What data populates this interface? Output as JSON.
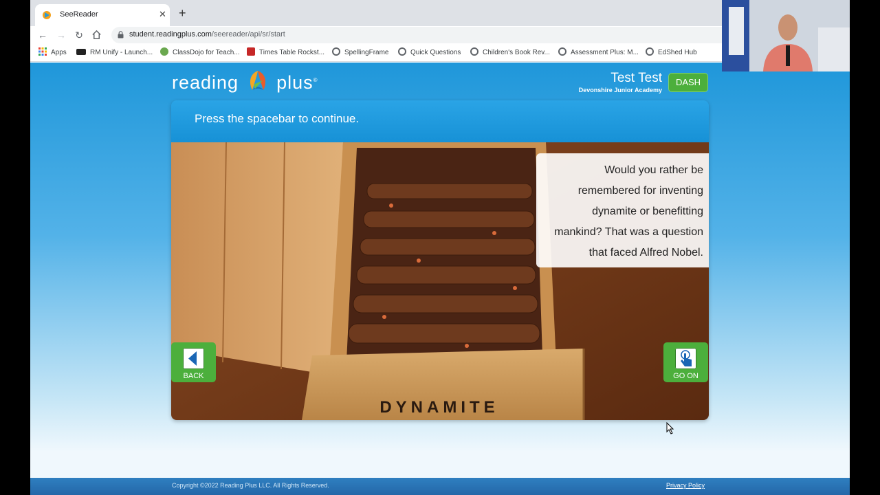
{
  "browser": {
    "tab_title": "SeeReader",
    "new_tab_icon": "+",
    "url_host": "student.readingplus.com",
    "url_path": "/seereader/api/sr/start"
  },
  "bookmarks": [
    {
      "label": "Apps",
      "icon": "apps-grid-icon",
      "color": "#e94235"
    },
    {
      "label": "RM Unify - Launch...",
      "icon": "rm-icon",
      "color": "#222222"
    },
    {
      "label": "ClassDojo for Teach...",
      "icon": "classdojo-icon",
      "color": "#6aa84f"
    },
    {
      "label": "Times Table Rockst...",
      "icon": "ttrs-icon",
      "color": "#c62828"
    },
    {
      "label": "SpellingFrame",
      "icon": "globe-icon",
      "color": "#5f6368"
    },
    {
      "label": "Quick Questions",
      "icon": "globe-icon",
      "color": "#5f6368"
    },
    {
      "label": "Children's Book Rev...",
      "icon": "globe-icon",
      "color": "#5f6368"
    },
    {
      "label": "Assessment Plus: M...",
      "icon": "globe-icon",
      "color": "#5f6368"
    },
    {
      "label": "EdShed Hub",
      "icon": "globe-icon",
      "color": "#5f6368"
    }
  ],
  "header": {
    "logo_left": "reading",
    "logo_right": "plus",
    "logo_mark": "®",
    "user_name": "Test Test",
    "school": "Devonshire Junior Academy",
    "dash_label": "DASH"
  },
  "panel": {
    "instruction": "Press the spacebar to continue.",
    "caption": "Would you rather be remembered for inventing dynamite or benefitting mankind? That was a question that faced Alfred Nobel.",
    "crate_label": "DYNAMITE",
    "back_label": "BACK",
    "goon_label": "GO ON"
  },
  "footer": {
    "copyright": "Copyright ©2022 Reading Plus LLC. All Rights Reserved.",
    "privacy": "Privacy Policy"
  },
  "colors": {
    "brand_blue": "#1f97da",
    "button_green": "#4caf3c",
    "footer_blue": "#2467a8"
  }
}
